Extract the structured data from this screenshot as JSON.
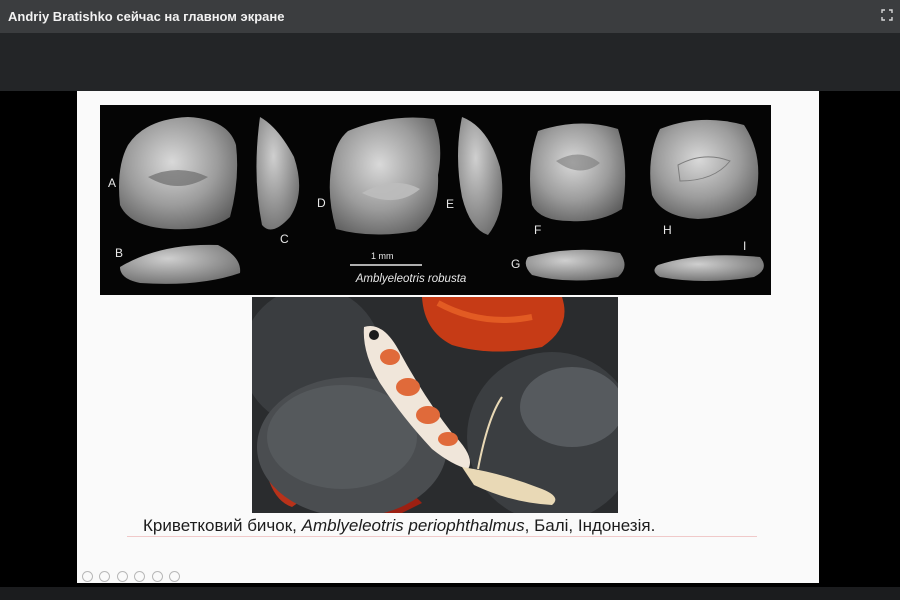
{
  "topbar": {
    "title": "Andriy Bratishko сейчас на главном экране"
  },
  "slide": {
    "otolith_labels": [
      "A",
      "B",
      "C",
      "D",
      "E",
      "F",
      "G",
      "H",
      "I"
    ],
    "scale_label": "1 mm",
    "species_label": "Amblyeleotris robusta",
    "caption": {
      "prefix": "Криветковий бичок, ",
      "species": "Amblyeleotris periophthalmus",
      "suffix": ", Балі, Індонезія."
    }
  },
  "colors": {
    "topbar_bg": "#3b3d3f",
    "band_bg": "#232527",
    "stage_bg": "#000000",
    "slide_bg": "#fafafa",
    "panel_bg": "#050505"
  }
}
